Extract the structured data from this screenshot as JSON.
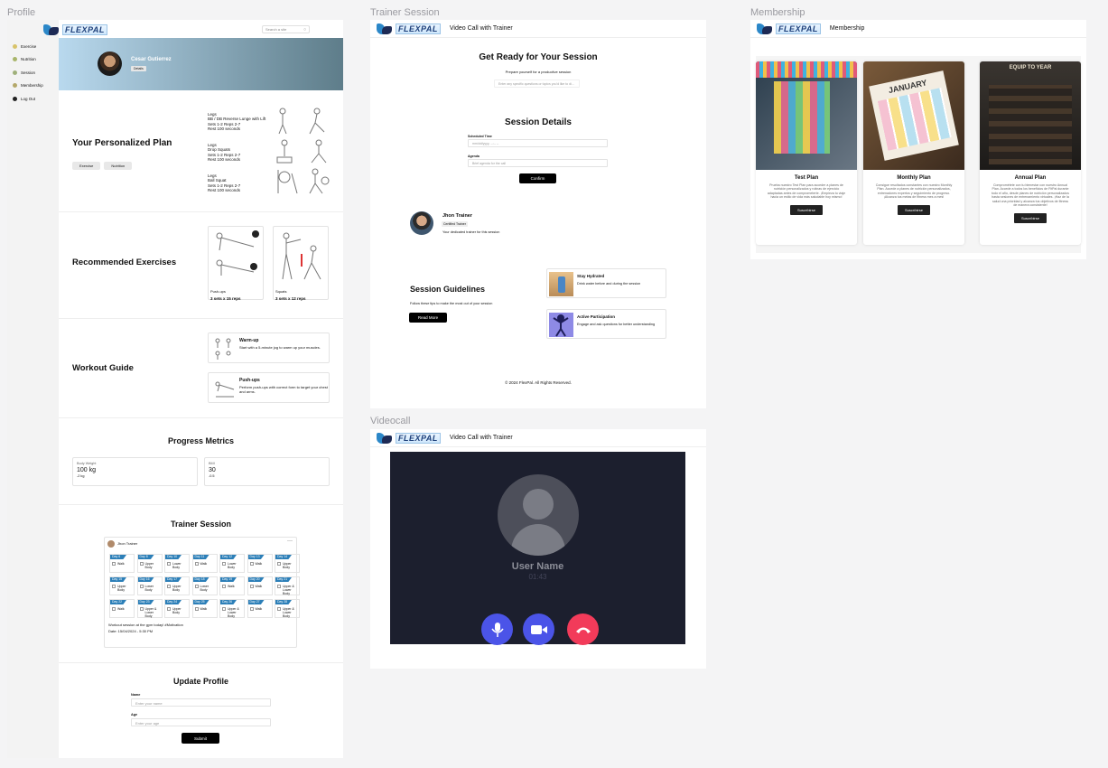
{
  "frames": {
    "profile": "Profile",
    "trainer_session": "Trainer Session",
    "membership": "Membership",
    "videocall": "Videocall"
  },
  "brand": {
    "logo": "FLEXPAL"
  },
  "profile": {
    "search_placeholder": "Search a site",
    "sidebar": [
      {
        "label": "Exercise",
        "icon": "star-icon"
      },
      {
        "label": "Nutrition",
        "icon": "leaf-icon"
      },
      {
        "label": "Session",
        "icon": "session-icon"
      },
      {
        "label": "Membership",
        "icon": "card-icon"
      },
      {
        "label": "Log Out",
        "icon": "logout-icon"
      }
    ],
    "user": {
      "name": "Cesar Gutierrez",
      "badge": "Details"
    },
    "plan": {
      "title": "Your Personalized Plan",
      "tabs": [
        "Exercise",
        "Nutrition"
      ],
      "items": [
        {
          "l1": "Legs",
          "l2": "BB / DB Reverse Lunge with Lift",
          "l3": "Sets 1-2 Reps 2-7",
          "l4": "Rest 100 seconds"
        },
        {
          "l1": "Legs",
          "l2": "Drop Squats",
          "l3": "Sets 1-2 Reps 2-7",
          "l4": "Rest 100 seconds"
        },
        {
          "l1": "Legs",
          "l2": "Ball Squat",
          "l3": "Sets 1-2 Reps 2-7",
          "l4": "Rest 100 seconds"
        }
      ]
    },
    "recommended": {
      "title": "Recommended Exercises",
      "items": [
        {
          "name": "Push-ups",
          "detail": "3 sets x 15 reps"
        },
        {
          "name": "Squats",
          "detail": "3 sets x 12 reps"
        }
      ]
    },
    "guide": {
      "title": "Workout Guide",
      "items": [
        {
          "name": "Warm-up",
          "desc": "Start with a 5-minute jog to warm up your muscles."
        },
        {
          "name": "Push-ups",
          "desc": "Perform push-ups with correct form to target your chest and arms."
        }
      ]
    },
    "metrics": {
      "title": "Progress Metrics",
      "items": [
        {
          "label": "Body Weight",
          "value": "100 kg",
          "delta": "-2 kg"
        },
        {
          "label": "BMI",
          "value": "30",
          "delta": "-0.5"
        }
      ]
    },
    "trainer": {
      "title": "Trainer Session",
      "post_author": "Jhon Trainer",
      "post_text": "Workout session at the gym today! #Motivation",
      "post_date": "Date: 15/04/2024 - 5:30 PM",
      "days": [
        {
          "d": "Day 6",
          "t": "Walk"
        },
        {
          "d": "Day 8",
          "t": "Upper Body"
        },
        {
          "d": "Day 10",
          "t": "Lower Body"
        },
        {
          "d": "Day 11",
          "t": "Walk"
        },
        {
          "d": "Day 12",
          "t": "Lower Body"
        },
        {
          "d": "Day 13",
          "t": "Walk"
        },
        {
          "d": "Day 14",
          "t": "Upper Body"
        },
        {
          "d": "Day 15",
          "t": "Upper Body"
        },
        {
          "d": "Day 16",
          "t": "Lower Body"
        },
        {
          "d": "Day 17",
          "t": "Upper Body"
        },
        {
          "d": "Day 18",
          "t": "Lower Body"
        },
        {
          "d": "Day 19",
          "t": "Walk"
        },
        {
          "d": "Day 20",
          "t": "Walk"
        },
        {
          "d": "Day 21",
          "t": "Upper & Lower Body"
        },
        {
          "d": "Day 22",
          "t": "Walk"
        },
        {
          "d": "Day 23",
          "t": "Upper & Lower Body"
        },
        {
          "d": "Day 24",
          "t": "Upper Body"
        },
        {
          "d": "Day 25",
          "t": "Walk"
        },
        {
          "d": "Day 26",
          "t": "Upper & Lower Body"
        },
        {
          "d": "Day 27",
          "t": "Walk"
        },
        {
          "d": "Day 28",
          "t": "Upper & Lower Body"
        }
      ]
    },
    "update": {
      "title": "Update Profile",
      "name_label": "Name",
      "name_placeholder": "Enter your name",
      "age_label": "Age",
      "age_placeholder": "Enter your age",
      "submit": "Submit"
    }
  },
  "session": {
    "header": "Video Call with Trainer",
    "ready_title": "Get Ready for Your Session",
    "ready_sub": "Prepare yourself for a productive session",
    "ready_placeholder": "Enter any specific questions or topics you'd like to di...",
    "details_title": "Session Details",
    "time_label": "Scheduled Time",
    "time_value": "mm/dd/yyyy, --:-- --",
    "agenda_label": "Agenda",
    "agenda_placeholder": "Brief agenda for the call",
    "confirm": "Confirm",
    "trainer_name": "Jhon Trainer",
    "trainer_badge": "Certified Trainer",
    "trainer_desc": "Your dedicated trainer for this session",
    "guidelines_title": "Session Guidelines",
    "guidelines_sub": "Follow these tips to make the most out of your session",
    "read_more": "Read More",
    "tips": [
      {
        "name": "Stay Hydrated",
        "desc": "Drink water before and during the session"
      },
      {
        "name": "Active Participation",
        "desc": "Engage and ask questions for better understanding"
      }
    ],
    "footer": "© 2024 FlexPal. All Rights Reserved."
  },
  "videocall": {
    "header": "Video Call with Trainer",
    "user_name": "User Name",
    "timer": "01:43",
    "colors": {
      "bg": "#1c1f2e",
      "mic": "#4b54e8",
      "cam": "#4b54e8",
      "hangup": "#f23b5a"
    }
  },
  "membership": {
    "header": "Membership",
    "plans": [
      {
        "name": "Test Plan",
        "desc": "Prueba nuestro Test Plan para acceder a planes de nutrición personalizados y rutinas de ejercicio adaptadas antes de comprometerte. ¡Empieza tu viaje hacia un estilo de vida más saludable hoy mismo!",
        "button": "Suscríbirse",
        "image_label": ""
      },
      {
        "name": "Monthly Plan",
        "desc": "Consigue resultados constantes con nuestro Monthly Plan. Accede a planes de nutrición personalizados, entrenadores expertos y seguimiento de progreso. ¡Alcanza tus metas de fitness mes a mes!",
        "button": "Suscríbirse",
        "image_label": "JANUARY"
      },
      {
        "name": "Annual Plan",
        "desc": "Comprométete con tu bienestar con nuestro Annual Plan. Accede a todos los beneficios de FitPal durante todo el año, desde planes de nutrición personalizados hasta sesiones de entrenamiento virtuales. ¡Haz de la salud una prioridad y alcanza tus objetivos de fitness de manera consistente!",
        "button": "Suscríbirse",
        "image_label": "EQUIP TO YEAR"
      }
    ]
  }
}
